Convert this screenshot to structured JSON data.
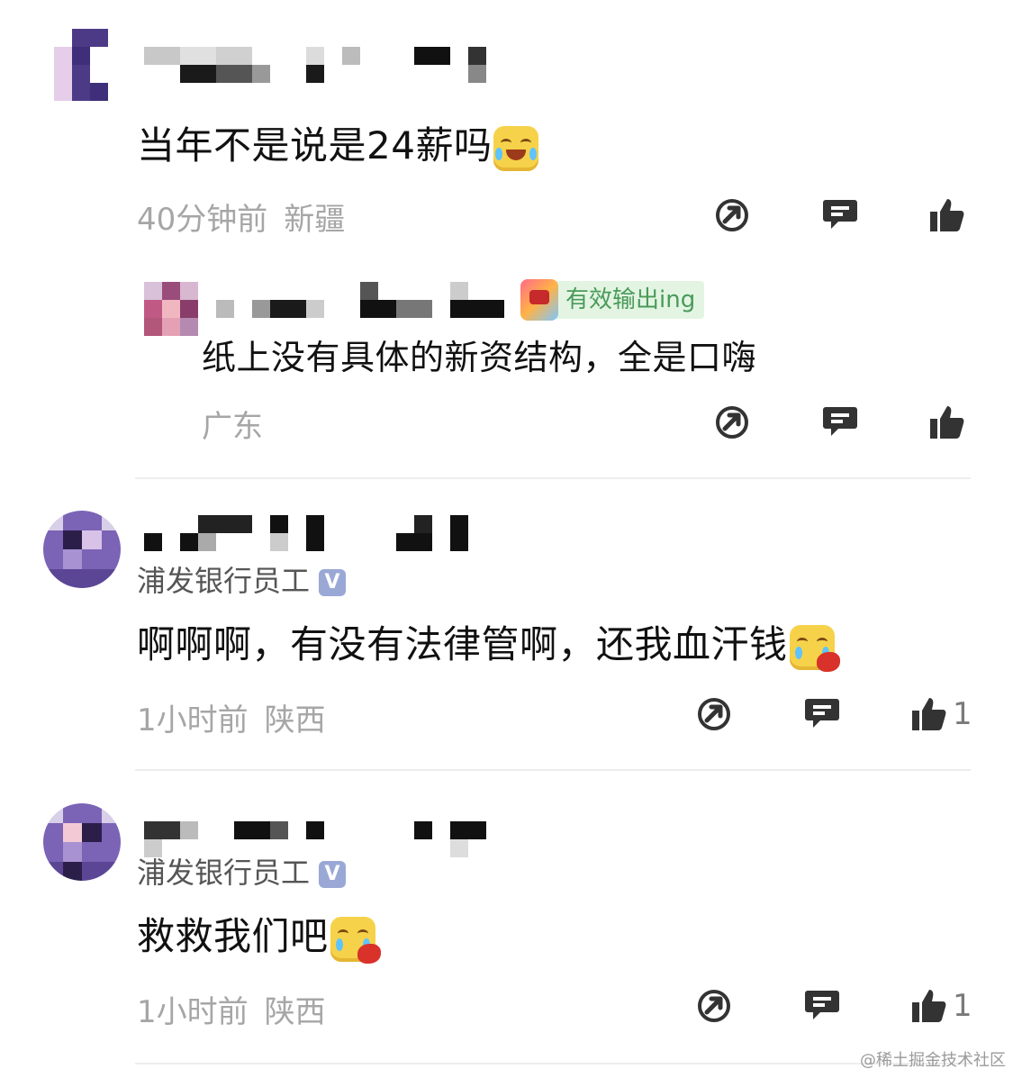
{
  "comments": [
    {
      "text": "当年不是说是24薪吗",
      "time": "40分钟前",
      "location": "新疆",
      "reply": {
        "tag": "有效输出ing",
        "text": "纸上没有具体的新资结构，全是口嗨",
        "location": "广东"
      }
    },
    {
      "badge": "浦发银行员工",
      "text": "啊啊啊，有没有法律管啊，还我血汗钱",
      "time": "1小时前",
      "location": "陕西",
      "likes": "1"
    },
    {
      "badge": "浦发银行员工",
      "text": "救救我们吧",
      "time": "1小时前",
      "location": "陕西",
      "likes": "1"
    }
  ],
  "verified_mark": "V",
  "watermark": "@稀土掘金技术社区",
  "icons": {
    "share": "share-icon",
    "comment": "comment-icon",
    "like": "thumbs-up-icon"
  },
  "colors": {
    "meta": "#a6a6a6",
    "icon": "#333333",
    "tag_bg": "#e3f5e2"
  }
}
